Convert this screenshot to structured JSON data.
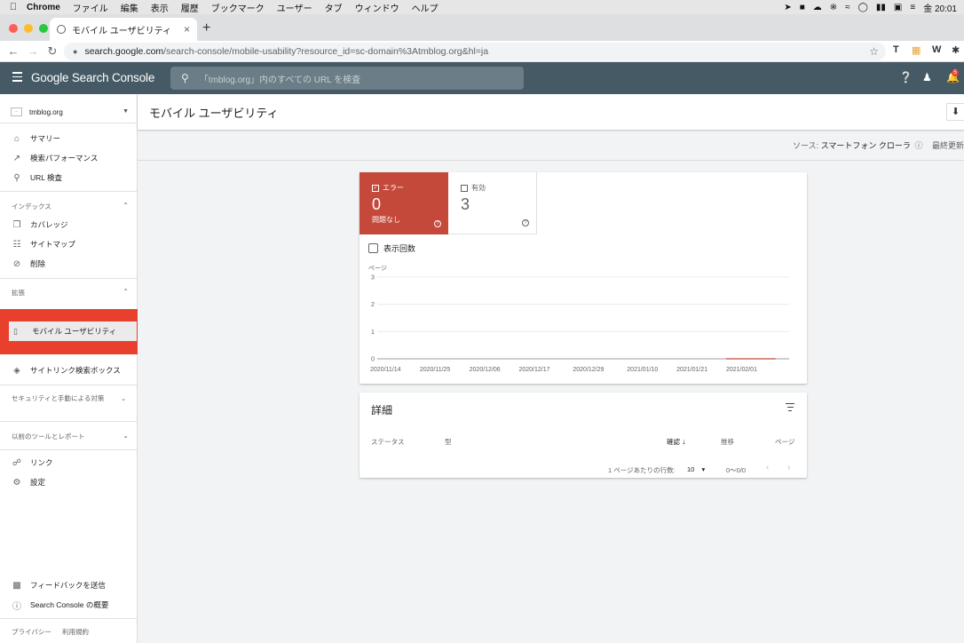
{
  "mac_menu": {
    "apple": "",
    "items": [
      "Chrome",
      "ファイル",
      "編集",
      "表示",
      "履歴",
      "ブックマーク",
      "ユーザー",
      "タブ",
      "ウィンドウ",
      "ヘルプ"
    ],
    "clock": "金 20:01"
  },
  "browser": {
    "tab_title": "モバイル ユーザビリティ",
    "new_tab": "+",
    "url_host": "search.google.com",
    "url_path": "/search-console/mobile-usability?resource_id=sc-domain%3Atmblog.org&hl=ja",
    "ext_icons": [
      "T",
      "W"
    ]
  },
  "header": {
    "logo": "Google Search Console",
    "search_placeholder": "「tmblog.org」内のすべての URL を検査",
    "notification_count": "5"
  },
  "sidebar": {
    "property": "tmblog.org",
    "items": [
      {
        "label": "サマリー",
        "icon": "home-icon"
      },
      {
        "label": "検索パフォーマンス",
        "icon": "trending-up-icon"
      },
      {
        "label": "URL 検査",
        "icon": "search-icon"
      }
    ],
    "section_index": "インデックス",
    "index_items": [
      {
        "label": "カバレッジ",
        "icon": "copy-icon"
      },
      {
        "label": "サイトマップ",
        "icon": "sitemap-icon"
      },
      {
        "label": "削除",
        "icon": "eye-off-icon"
      }
    ],
    "section_enhancements": "拡張",
    "selected_item": "モバイル ユーザビリティ",
    "sitelinks_item": "サイトリンク検索ボックス",
    "section_security": "セキュリティと手動による対策",
    "section_legacy": "以前のツールとレポート",
    "links_item": "リンク",
    "settings_item": "設定",
    "feedback_item": "フィードバックを送信",
    "about_item": "Search Console の概要",
    "footer_privacy": "プライバシー",
    "footer_terms": "利用規約"
  },
  "main": {
    "title": "モバイル ユーザビリティ",
    "source_label": "ソース:",
    "source_value": "スマートフォン クローラ",
    "last_updated": "最終更新"
  },
  "summary": {
    "error_label": "エラー",
    "error_count": "0",
    "error_sub": "問題なし",
    "valid_label": "有効",
    "valid_count": "3",
    "impressions_label": "表示回数",
    "colors": {
      "error": "#c5493b",
      "line": "#c5493b"
    }
  },
  "chart_data": {
    "type": "line",
    "ylabel": "ページ",
    "ylim": [
      0,
      3
    ],
    "yticks": [
      "0",
      "1",
      "2",
      "3"
    ],
    "x_tick_labels": [
      "2020/11/14",
      "2020/11/25",
      "2020/12/06",
      "2020/12/17",
      "2020/12/29",
      "2021/01/10",
      "2021/01/21",
      "2021/02/01"
    ],
    "series": [
      {
        "color": "#c5493b",
        "x": [
          "2021/02/01",
          "2021/02/12"
        ],
        "values": [
          0,
          0
        ]
      }
    ],
    "grid": true
  },
  "details": {
    "title": "詳細",
    "columns": [
      "ステータス",
      "型",
      "確認",
      "推移",
      "ページ"
    ],
    "sort_indicator": "↓",
    "rows_per_page_label": "1 ページあたりの行数:",
    "rows_per_page_value": "10",
    "range": "0〜0/0"
  }
}
